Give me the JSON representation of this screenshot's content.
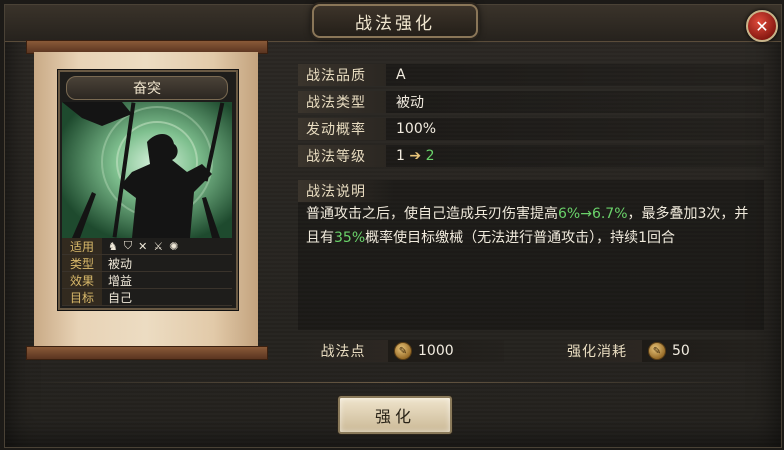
{
  "window": {
    "title": "战法强化"
  },
  "card": {
    "name": "奋突",
    "rows": [
      {
        "label": "适用",
        "icons": [
          "horse-icon",
          "shield-icon",
          "crossbow-icon",
          "sword-icon",
          "wheel-icon"
        ]
      },
      {
        "label": "类型",
        "value": "被动"
      },
      {
        "label": "效果",
        "value": "增益"
      },
      {
        "label": "目标",
        "value": "自己"
      }
    ]
  },
  "attributes": [
    {
      "label": "战法品质",
      "value": "A"
    },
    {
      "label": "战法类型",
      "value": "被动"
    },
    {
      "label": "发动概率",
      "value": "100%"
    },
    {
      "label": "战法等级",
      "from": "1",
      "to": "2"
    }
  ],
  "description": {
    "label": "战法说明",
    "p1": "普通攻击之后，使自己造成兵刃伤害提高",
    "h1": "6%→6.7%",
    "p2": "，最多叠加3次，并且有",
    "h2": "35%",
    "p3": "概率使目标缴械（无法进行普通攻击），持续1回合"
  },
  "bottom": {
    "points_label": "战法点",
    "points_value": "1000",
    "cost_label": "强化消耗",
    "cost_value": "50"
  },
  "button": {
    "label": "强化"
  },
  "colors": {
    "highlight": "#6ad26a",
    "close": "#c0281c"
  }
}
